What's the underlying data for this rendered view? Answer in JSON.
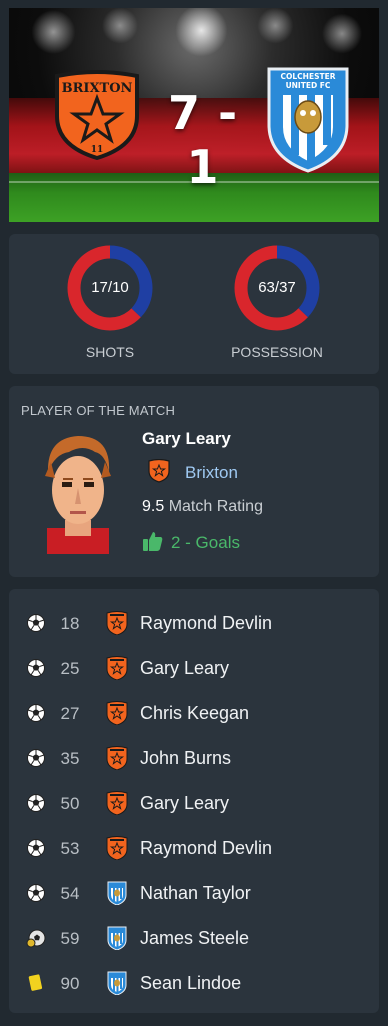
{
  "match": {
    "home_team": "Brixton",
    "away_team": "Colchester United FC",
    "home_crest_text": "BRIXTON",
    "home_crest_sub": "11",
    "away_crest_line1": "COLCHESTER",
    "away_crest_line2": "UNITED FC",
    "score": "7 - 1",
    "home_score": 7,
    "away_score": 1
  },
  "stats": {
    "shots": {
      "value": "17/10",
      "label": "SHOTS",
      "home": 17,
      "away": 10
    },
    "possession": {
      "value": "63/37",
      "label": "POSSESSION",
      "home": 63,
      "away": 37
    },
    "colors": {
      "home": "#d9262c",
      "away": "#1f3fa3"
    }
  },
  "potm": {
    "title": "PLAYER OF THE MATCH",
    "name": "Gary Leary",
    "club": "Brixton",
    "rating": "9.5",
    "rating_label": "Match Rating",
    "goals": "2 - Goals"
  },
  "events": [
    {
      "type": "goal",
      "icon": "football-icon",
      "minute": "18",
      "team": "home",
      "player": "Raymond Devlin"
    },
    {
      "type": "goal",
      "icon": "football-icon",
      "minute": "25",
      "team": "home",
      "player": "Gary Leary"
    },
    {
      "type": "goal",
      "icon": "football-icon",
      "minute": "27",
      "team": "home",
      "player": "Chris Keegan"
    },
    {
      "type": "goal",
      "icon": "football-icon",
      "minute": "35",
      "team": "home",
      "player": "John Burns"
    },
    {
      "type": "goal",
      "icon": "football-icon",
      "minute": "50",
      "team": "home",
      "player": "Gary Leary"
    },
    {
      "type": "goal",
      "icon": "football-icon",
      "minute": "53",
      "team": "home",
      "player": "Raymond Devlin"
    },
    {
      "type": "goal",
      "icon": "football-icon",
      "minute": "54",
      "team": "away",
      "player": "Nathan Taylor"
    },
    {
      "type": "penalty-goal",
      "icon": "penalty-football-icon",
      "minute": "59",
      "team": "away",
      "player": "James Steele"
    },
    {
      "type": "yellow-card",
      "icon": "yellow-card-icon",
      "minute": "90",
      "team": "away",
      "player": "Sean Lindoe"
    }
  ]
}
